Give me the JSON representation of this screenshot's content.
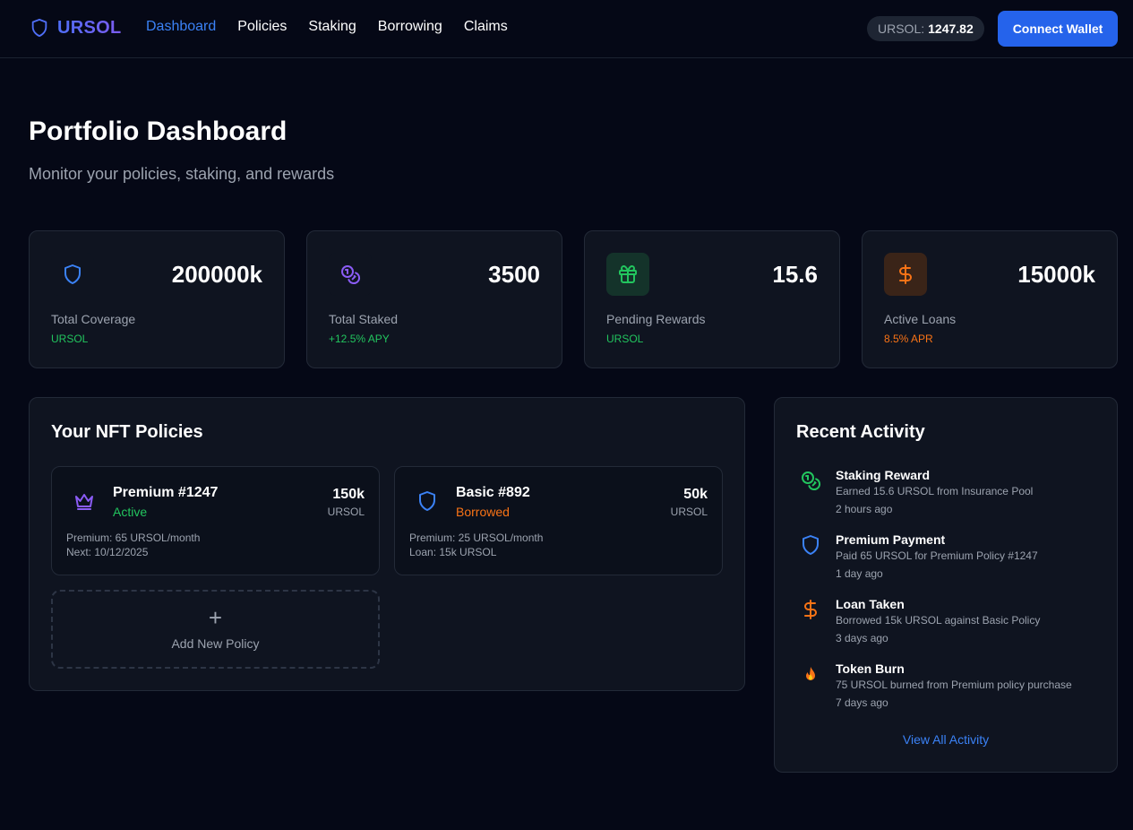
{
  "header": {
    "brand": "URSOL",
    "nav": [
      "Dashboard",
      "Policies",
      "Staking",
      "Borrowing",
      "Claims"
    ],
    "active_nav": "Dashboard",
    "balance_label": "URSOL:",
    "balance_value": "1247.82",
    "connect_label": "Connect Wallet"
  },
  "page": {
    "title": "Portfolio Dashboard",
    "subtitle": "Monitor your policies, staking, and rewards"
  },
  "stats": [
    {
      "icon": "shield-icon",
      "value": "200000k",
      "label": "Total Coverage",
      "sub": "URSOL",
      "sub_color": "#22c55e"
    },
    {
      "icon": "coins-icon",
      "value": "3500",
      "label": "Total Staked",
      "sub": "+12.5% APY",
      "sub_color": "#22c55e"
    },
    {
      "icon": "gift-icon",
      "value": "15.6",
      "label": "Pending Rewards",
      "sub": "URSOL",
      "sub_color": "#22c55e"
    },
    {
      "icon": "dollar-icon",
      "value": "15000k",
      "label": "Active Loans",
      "sub": "8.5% APR",
      "sub_color": "#f97316"
    }
  ],
  "policies": {
    "title": "Your NFT Policies",
    "items": [
      {
        "icon": "crown-icon",
        "name": "Premium #1247",
        "status": "Active",
        "status_color": "#22c55e",
        "amount": "150k",
        "unit": "URSOL",
        "detail1": "Premium: 65 URSOL/month",
        "detail2": "Next: 10/12/2025"
      },
      {
        "icon": "shield-icon",
        "name": "Basic #892",
        "status": "Borrowed",
        "status_color": "#f97316",
        "amount": "50k",
        "unit": "URSOL",
        "detail1": "Premium: 25 URSOL/month",
        "detail2": "Loan: 15k URSOL"
      }
    ],
    "add_icon": "+",
    "add_label": "Add New Policy"
  },
  "activity": {
    "title": "Recent Activity",
    "items": [
      {
        "icon": "coins-icon",
        "title": "Staking Reward",
        "desc": "Earned 15.6 URSOL from Insurance Pool",
        "time": "2 hours ago"
      },
      {
        "icon": "shield-icon",
        "title": "Premium Payment",
        "desc": "Paid 65 URSOL for Premium Policy #1247",
        "time": "1 day ago"
      },
      {
        "icon": "dollar-icon",
        "title": "Loan Taken",
        "desc": "Borrowed 15k URSOL against Basic Policy",
        "time": "3 days ago"
      },
      {
        "icon": "fire-icon",
        "title": "Token Burn",
        "desc": "75 URSOL burned from Premium policy purchase",
        "time": "7 days ago"
      }
    ],
    "view_all": "View All Activity"
  },
  "colors": {
    "accent": "#2563eb",
    "link": "#3b82f6",
    "success": "#22c55e",
    "warning": "#f97316",
    "purple": "#8b5cf6"
  }
}
